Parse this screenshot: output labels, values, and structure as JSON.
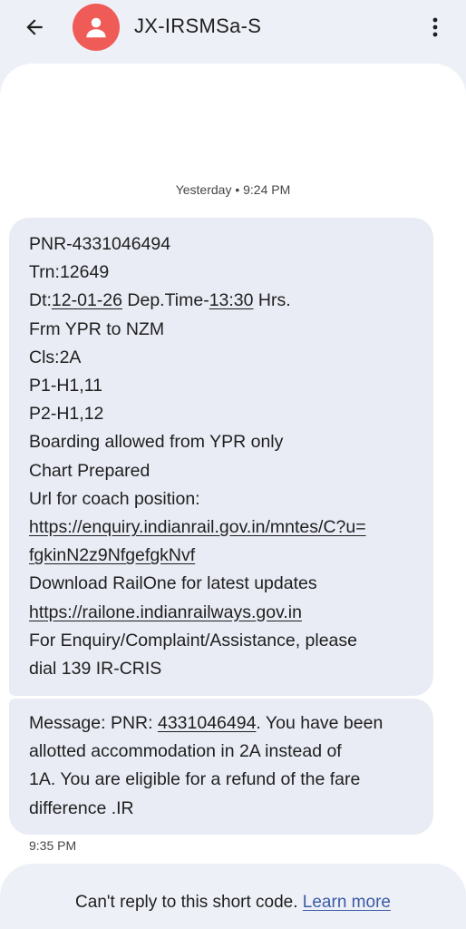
{
  "header": {
    "title": "JX-IRSMSa-S",
    "back_icon": "arrow-back-icon",
    "avatar_icon": "person-icon",
    "more_icon": "more-vert-icon",
    "avatar_color": "#ef5b57"
  },
  "thread": {
    "day_timestamp": "Yesterday • 9:24 PM",
    "message1": {
      "pnr": "PNR-4331046494",
      "train": "Trn:12649",
      "date_prefix": "Dt:",
      "date": "12-01-26",
      "dep_label": " Dep.Time-",
      "dep_time": "13:30",
      "hrs": " Hrs.",
      "route": "Frm YPR to NZM",
      "class": "Cls:2A",
      "p1": "P1-H1,11",
      "p2": "P2-H1,12",
      "boarding": "Boarding allowed from YPR only",
      "chart": "Chart Prepared",
      "url_label": "Url for coach position:",
      "url_part1": "https://enquiry.indianrail.gov.in/mntes/C?u=",
      "url_part2": "fgkinN2z9NfgefgkNvf",
      "download": "Download RailOne for latest updates",
      "railone_url": "https://railone.indianrailways.gov.in",
      "enquiry_line1": "For Enquiry/Complaint/Assistance, please",
      "enquiry_line2": "dial 139 IR-CRIS"
    },
    "message2": {
      "prefix": "Message: PNR: ",
      "pnr_link": "4331046494",
      "suffix": ". You have been",
      "line2": "allotted accommodation in 2A instead of",
      "line3": "1A. You are eligible for a refund of the fare",
      "line4": "difference .IR"
    },
    "message_time": "9:35 PM"
  },
  "footer": {
    "text": "Can't reply to this short code.",
    "link": "Learn more",
    "link_color": "#3b5ba5"
  }
}
